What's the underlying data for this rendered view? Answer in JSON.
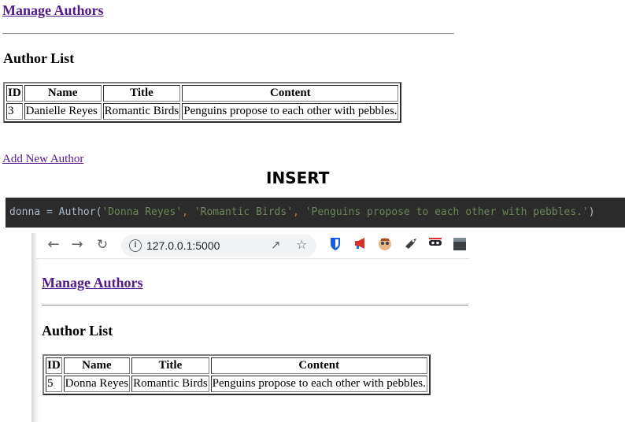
{
  "top": {
    "manage_link": "Manage Authors",
    "list_heading": "Author List",
    "columns": [
      "ID",
      "Name",
      "Title",
      "Content"
    ],
    "row": [
      "3",
      "Danielle Reyes",
      "Romantic Birds",
      "Penguins propose to each other with pebbles."
    ],
    "add_link": "Add New Author"
  },
  "insert_label": "INSERT",
  "code": {
    "prefix": "donna = Author(",
    "arg1": "'Donna Reyes'",
    "sep1": ", ",
    "arg2": "'Romantic Birds'",
    "sep2": ", ",
    "arg3": "'Penguins propose to each other with pebbles.'",
    "suffix": ")"
  },
  "browser": {
    "url": "127.0.0.1:5000",
    "icons": [
      "back-icon",
      "forward-icon",
      "reload-icon",
      "site-info-icon",
      "share-icon",
      "bookmark-star-icon",
      "bitwarden-icon",
      "megaphone-icon",
      "avatar-extension-icon",
      "bird-extension-icon",
      "mask-extension-icon",
      "dark-extension-icon"
    ],
    "colors": {
      "bitwarden": "#175ddc",
      "megaphone": "#d93025"
    }
  },
  "bottom": {
    "manage_link": "Manage Authors",
    "list_heading": "Author List",
    "columns": [
      "ID",
      "Name",
      "Title",
      "Content"
    ],
    "row": [
      "5",
      "Donna Reyes",
      "Romantic Birds",
      "Penguins propose to each other with pebbles."
    ]
  }
}
